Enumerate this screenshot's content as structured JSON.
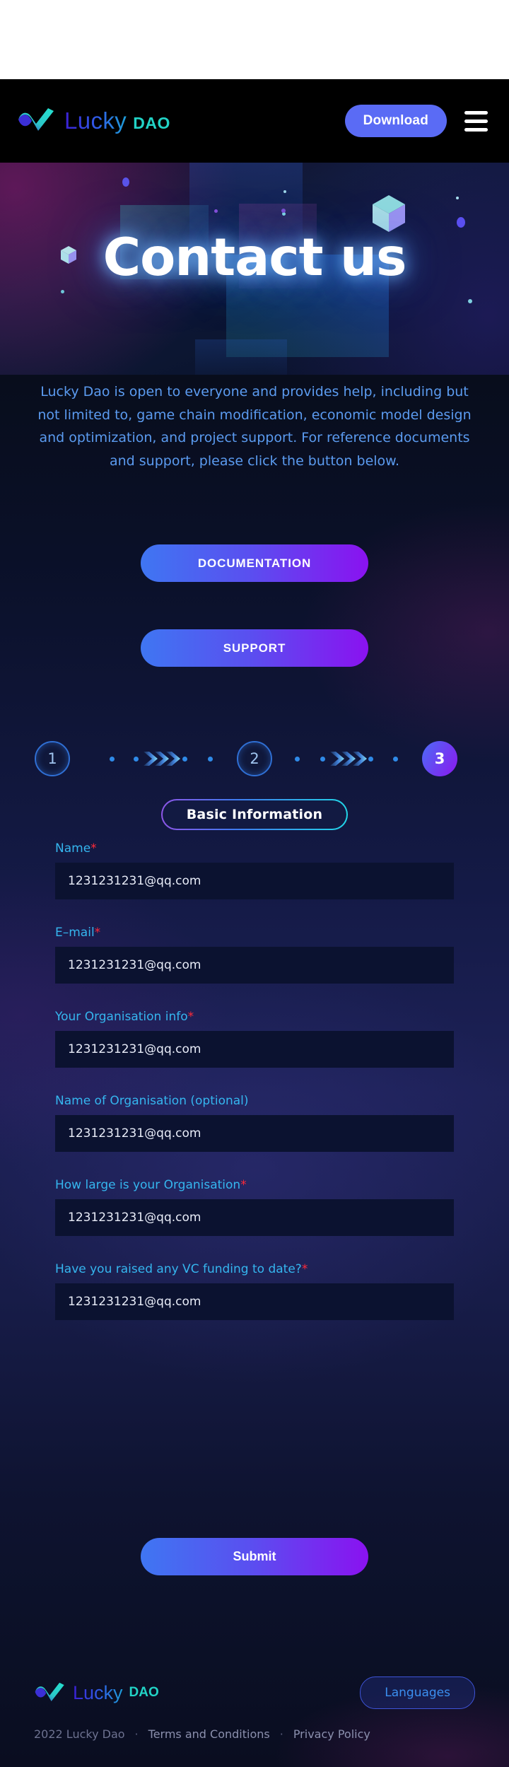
{
  "header": {
    "brand_name": "Lucky",
    "brand_suffix": "DAO",
    "download_label": "Download",
    "menu_icon": "hamburger-icon"
  },
  "hero": {
    "title": "Contact us"
  },
  "main": {
    "description": "Lucky Dao is open to everyone and provides help, including but not limited to, game chain modification, economic model design and optimization, and project support. For reference documents and support, please click the button below.",
    "documentation_label": "DOCUMENTATION",
    "support_label": "SUPPORT"
  },
  "steps": {
    "items": [
      {
        "label": "1",
        "state": "idle"
      },
      {
        "label": "2",
        "state": "idle"
      },
      {
        "label": "3",
        "state": "active"
      }
    ]
  },
  "tab": {
    "label": "Basic Information"
  },
  "form": {
    "fields": [
      {
        "label": "Name",
        "required": true,
        "value": "1231231231@qq.com"
      },
      {
        "label": "E–mail",
        "required": true,
        "value": "1231231231@qq.com"
      },
      {
        "label": "Your Organisation info",
        "required": true,
        "value": "1231231231@qq.com"
      },
      {
        "label": "Name of Organisation (optional)",
        "required": false,
        "value": "1231231231@qq.com"
      },
      {
        "label": "How large is your Organisation",
        "required": true,
        "value": "1231231231@qq.com"
      },
      {
        "label": "Have you raised any VC funding to date?",
        "required": true,
        "value": "1231231231@qq.com"
      }
    ],
    "submit_label": "Submit"
  },
  "footer": {
    "brand_name": "Lucky",
    "brand_suffix": "DAO",
    "languages_label": "Languages",
    "copyright": "2022 Lucky Dao",
    "terms_label": "Terms and Conditions",
    "privacy_label": "Privacy Policy",
    "separator": "·"
  },
  "colors": {
    "accent_blue": "#5a6bf5",
    "accent_purple": "#8a12f0",
    "label_cyan": "#35b6ef",
    "required_red": "#ff2a38",
    "brand_teal": "#22d3c6",
    "desc_blue": "#5b9bf0",
    "header_bg": "#000000",
    "input_bg": "#0b1230"
  }
}
